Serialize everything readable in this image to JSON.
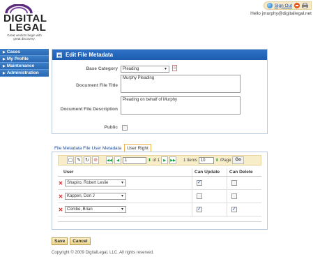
{
  "brand": {
    "line1": "DIGITAL",
    "line2": "LEGAL",
    "tagline": "Great verdicts begin with great discovery."
  },
  "header": {
    "signout_label": "Sign Out",
    "greeting": "Hello jmurphy@digitallegal.net"
  },
  "sidebar": {
    "items": [
      {
        "label": "Cases"
      },
      {
        "label": "My Profile"
      },
      {
        "label": "Maintenance"
      },
      {
        "label": "Administration"
      }
    ]
  },
  "panel": {
    "title": "Edit File Metadata",
    "fields": {
      "base_category_label": "Base Category",
      "base_category_value": "Pleading",
      "doc_title_label": "Document File Title",
      "doc_title_value": "Murphy Pleading",
      "doc_desc_label": "Document File Description",
      "doc_desc_value": "Pleading on behalf of Murphy",
      "public_label": "Public",
      "public_checked": false
    }
  },
  "tabs": [
    {
      "label": "File Metadata File User Metadata",
      "active": false
    },
    {
      "label": "User Right",
      "active": true
    }
  ],
  "pager": {
    "page": "1",
    "of_text": "of 1",
    "items_text": "1 Items",
    "page_size": "10",
    "per_page_text": "/Page",
    "go_label": "Go"
  },
  "grid": {
    "headers": {
      "user": "User",
      "can_update": "Can Update",
      "can_delete": "Can Delete"
    },
    "rows": [
      {
        "user": "Shapiro, Robert Leslie",
        "can_update": true,
        "can_delete": false
      },
      {
        "user": "Kappen, Don J",
        "can_update": false,
        "can_delete": false
      },
      {
        "user": "Combe, Brian",
        "can_update": true,
        "can_delete": true
      }
    ]
  },
  "actions": {
    "save_label": "Save",
    "cancel_label": "Cancel"
  },
  "footer": {
    "copyright": "Copyright © 2009 DigitalLegal, LLC. All rights reserved."
  },
  "colors": {
    "header_blue": "#2e72c8",
    "nav_blue": "#3c7fc9",
    "toolbar_gold": "#f7edc9",
    "logo_purple": "#5c2a7e"
  }
}
